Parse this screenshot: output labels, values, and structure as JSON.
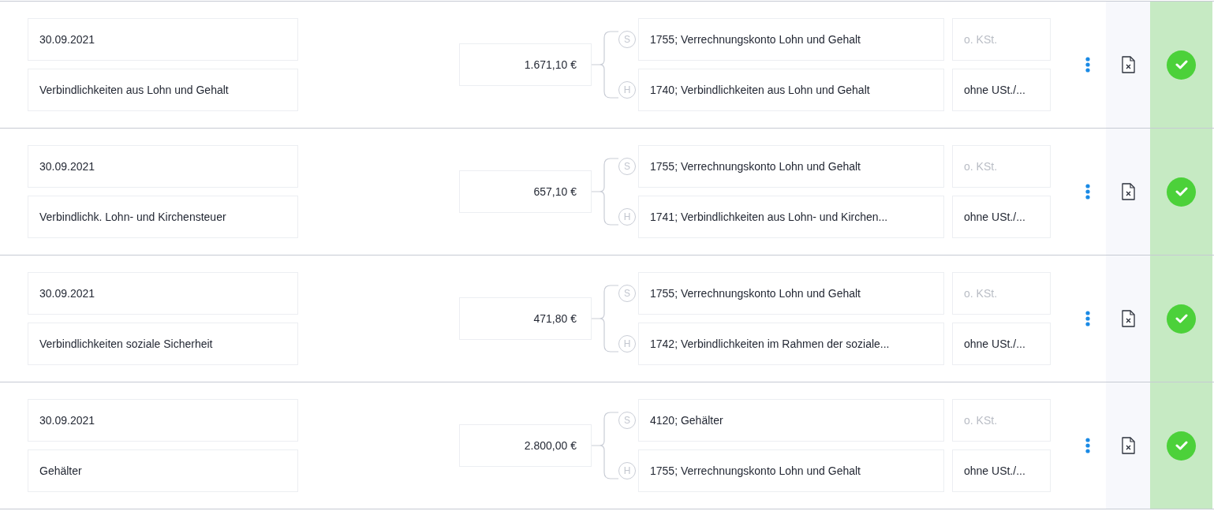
{
  "bookings": [
    {
      "date": "30.09.2021",
      "description": "Verbindlichkeiten aus Lohn und Gehalt",
      "amount": "1.671,10 €",
      "debit": {
        "marker": "S",
        "account": "1755; Verrechnungskonto Lohn und Gehalt"
      },
      "credit": {
        "marker": "H",
        "account": "1740; Verbindlichkeiten aus Lohn und Gehalt"
      },
      "cost_center": {
        "placeholder": "o. KSt."
      },
      "tax": "ohne USt./...",
      "confirmed": true
    },
    {
      "date": "30.09.2021",
      "description": "Verbindlichk. Lohn- und Kirchensteuer",
      "amount": "657,10 €",
      "debit": {
        "marker": "S",
        "account": "1755; Verrechnungskonto Lohn und Gehalt"
      },
      "credit": {
        "marker": "H",
        "account": "1741; Verbindlichkeiten aus Lohn- und Kirchen..."
      },
      "cost_center": {
        "placeholder": "o. KSt."
      },
      "tax": "ohne USt./...",
      "confirmed": true
    },
    {
      "date": "30.09.2021",
      "description": "Verbindlichkeiten soziale Sicherheit",
      "amount": "471,80 €",
      "debit": {
        "marker": "S",
        "account": "1755; Verrechnungskonto Lohn und Gehalt"
      },
      "credit": {
        "marker": "H",
        "account": "1742; Verbindlichkeiten im Rahmen der soziale..."
      },
      "cost_center": {
        "placeholder": "o. KSt."
      },
      "tax": "ohne USt./...",
      "confirmed": true
    },
    {
      "date": "30.09.2021",
      "description": "Gehälter",
      "amount": "2.800,00 €",
      "debit": {
        "marker": "S",
        "account": "4120; Gehälter"
      },
      "credit": {
        "marker": "H",
        "account": "1755; Verrechnungskonto Lohn und Gehalt"
      },
      "cost_center": {
        "placeholder": "o. KSt."
      },
      "tax": "ohne USt./...",
      "confirmed": true
    }
  ]
}
